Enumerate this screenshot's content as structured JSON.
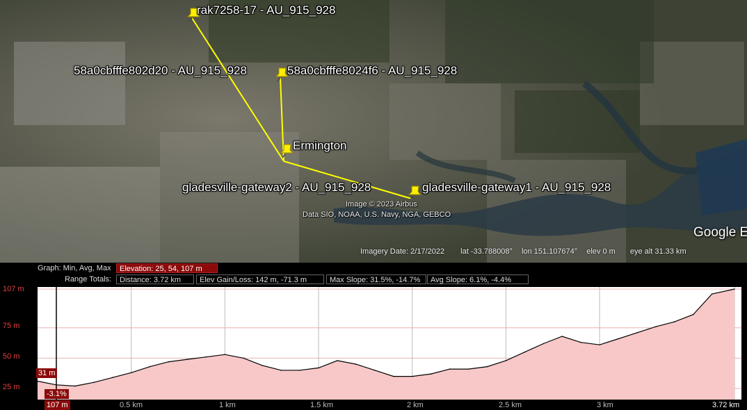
{
  "map": {
    "pins": [
      {
        "label": "rak7258-17 - AU_915_928"
      },
      {
        "label": "58a0cbfffe802d20 - AU_915_928"
      },
      {
        "label": "58a0cbfffe8024f6 - AU_915_928"
      },
      {
        "label": "Ermington"
      },
      {
        "label": "gladesville-gateway2 - AU_915_928"
      },
      {
        "label": "gladesville-gateway1 - AU_915_928"
      }
    ],
    "credit_line1": "Image © 2023 Airbus",
    "credit_line2": "Data SIO, NOAA, U.S. Navy, NGA, GEBCO",
    "logo": "Google E",
    "status": {
      "imagery_date": "Imagery Date: 2/17/2022",
      "lat": "lat  -33.788008°",
      "lon": "lon  151.107674°",
      "elev": "elev    0 m",
      "eye_alt": "eye alt  31.33 km"
    },
    "path_color": "#ffff00",
    "pin_color": "#ffee00"
  },
  "profile": {
    "graph_label": "Graph: Min, Avg, Max",
    "elevation": "Elevation: 25, 54, 107 m",
    "range_label": "Range Totals:",
    "distance": "Distance: 3.72 km",
    "gain_loss": "Elev Gain/Loss: 142 m, -71.3 m",
    "max_slope": "Max Slope: 31.5%, -14.7%",
    "avg_slope": "Avg Slope: 6.1%, -4.4%",
    "cursor_elev": "31 m",
    "cursor_slope": "-3.1%",
    "cursor_max": "107 m",
    "fill_color": "#f8c8c8",
    "line_color": "#000000"
  },
  "chart_data": {
    "type": "area",
    "xlabel": "",
    "ylabel": "",
    "xlim": [
      0,
      3.72
    ],
    "ylim": [
      20,
      107
    ],
    "y_ticks": [
      "107 m",
      "75 m",
      "50 m",
      "25 m"
    ],
    "y_tick_values": [
      107,
      75,
      50,
      25
    ],
    "x_ticks": [
      "0.5 km",
      "1 km",
      "1.5 km",
      "2 km",
      "2.5 km",
      "3 km",
      "3.72 km"
    ],
    "x_tick_values": [
      0.5,
      1,
      1.5,
      2,
      2.5,
      3,
      3.72
    ],
    "series": [
      {
        "x": [
          0,
          0.1,
          0.2,
          0.3,
          0.4,
          0.5,
          0.6,
          0.7,
          0.8,
          0.9,
          1.0,
          1.1,
          1.2,
          1.3,
          1.4,
          1.5,
          1.6,
          1.7,
          1.8,
          1.9,
          2.0,
          2.1,
          2.2,
          2.3,
          2.4,
          2.5,
          2.6,
          2.7,
          2.8,
          2.9,
          3.0,
          3.1,
          3.2,
          3.3,
          3.4,
          3.5,
          3.6,
          3.72
        ],
        "y": [
          31,
          28,
          27,
          30,
          34,
          38,
          43,
          47,
          49,
          51,
          53,
          50,
          44,
          40,
          40,
          42,
          48,
          45,
          40,
          35,
          35,
          37,
          41,
          41,
          43,
          48,
          55,
          62,
          68,
          63,
          61,
          66,
          71,
          76,
          80,
          86,
          103,
          107
        ]
      }
    ]
  }
}
